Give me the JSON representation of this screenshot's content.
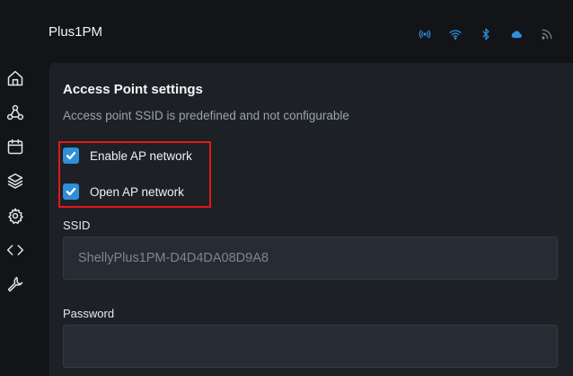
{
  "header": {
    "device_title": "Plus1PM",
    "status_icons": [
      "broadcast-icon",
      "wifi-icon",
      "bluetooth-icon",
      "cloud-icon",
      "rss-icon"
    ],
    "status_icon_color": "#2f8fd8"
  },
  "sidebar": {
    "items": [
      {
        "icon": "home-icon"
      },
      {
        "icon": "webhooks-icon"
      },
      {
        "icon": "calendar-icon"
      },
      {
        "icon": "layers-icon"
      },
      {
        "icon": "gear-icon"
      },
      {
        "icon": "code-icon"
      },
      {
        "icon": "wrench-icon"
      }
    ]
  },
  "panel": {
    "title": "Access Point settings",
    "subtitle": "Access point SSID is predefined and not configurable",
    "enable_ap_label": "Enable AP network",
    "enable_ap_checked": true,
    "open_ap_label": "Open AP network",
    "open_ap_checked": true,
    "ssid_label": "SSID",
    "ssid_value": "ShellyPlus1PM-D4D4DA08D9A8",
    "password_label": "Password",
    "password_value": ""
  },
  "colors": {
    "accent": "#2f8fd8",
    "highlight": "#e0191b",
    "panel_bg": "#1d2126",
    "page_bg": "#121417"
  }
}
